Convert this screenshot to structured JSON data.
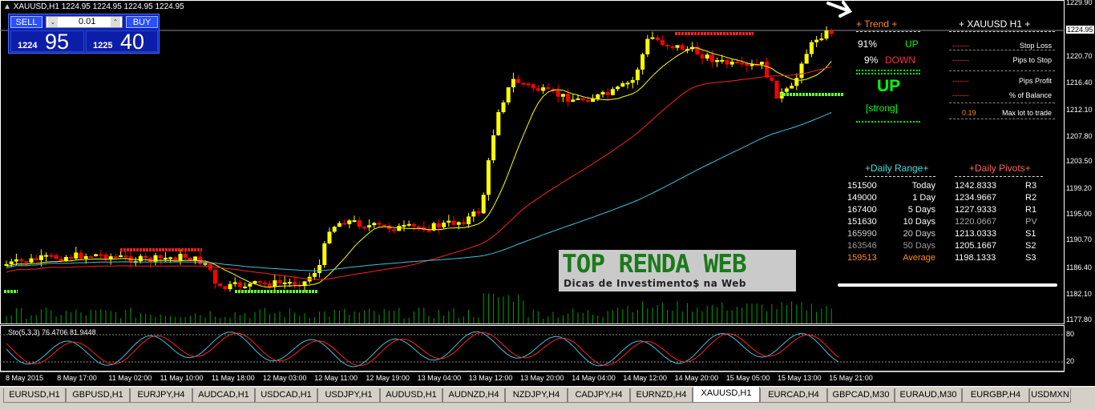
{
  "window": {
    "symbol_header": "XAUUSD,H1  1224.95 1224.95 1224.95 1224.95"
  },
  "trade_panel": {
    "sell_label": "SELL",
    "buy_label": "BUY",
    "lot_value": "0.01",
    "sell_small": "1224",
    "sell_big": "95",
    "buy_small": "1225",
    "buy_big": "40"
  },
  "price_axis": {
    "labels": [
      "1229.90",
      "1224.95",
      "1220.70",
      "1216.40",
      "1212.10",
      "1207.80",
      "1203.50",
      "1199.20",
      "1195.00",
      "1190.70",
      "1186.40",
      "1182.10",
      "1177.80"
    ],
    "current_price": "1224.95",
    "sto_labels": [
      "80",
      "20"
    ]
  },
  "time_axis": {
    "labels": [
      "8 May 2015",
      "8 May 17:00",
      "11 May 02:00",
      "11 May 10:00",
      "11 May 18:00",
      "12 May 03:00",
      "12 May 11:00",
      "12 May 19:00",
      "13 May 04:00",
      "13 May 12:00",
      "13 May 20:00",
      "14 May 04:00",
      "14 May 12:00",
      "14 May 20:00",
      "15 May 05:00",
      "15 May 13:00",
      "15 May 21:00"
    ]
  },
  "stochastic": {
    "label": "Sto(5,3,3) 76.4706 81.9448"
  },
  "trend_panel": {
    "title": "+   Trend   +",
    "up_pct": "91%",
    "up_label": "UP",
    "down_pct": "9%",
    "down_label": "DOWN",
    "direction": "UP",
    "strength": "[strong]"
  },
  "info_panel": {
    "title": "+   XAUUSD  H1   +",
    "rows": [
      {
        "value": "-------",
        "label": "Stop Loss"
      },
      {
        "value": "-------",
        "label": "Pips to Stop"
      },
      {
        "value": "-------",
        "label": "Pips Profit"
      },
      {
        "value": "-------",
        "label": "% of Balance"
      },
      {
        "value": "0.19",
        "label": "Max lot to trade"
      }
    ]
  },
  "daily_range": {
    "title": "+Daily Range+",
    "rows": [
      {
        "value": "151500",
        "label": "Today"
      },
      {
        "value": "149000",
        "label": "1 Day"
      },
      {
        "value": "167400",
        "label": "5 Days"
      },
      {
        "value": "151630",
        "label": "10 Days"
      },
      {
        "value": "165990",
        "label": "20 Days"
      },
      {
        "value": "163546",
        "label": "50 Days"
      },
      {
        "value": "159513",
        "label": "Average"
      }
    ]
  },
  "daily_pivots": {
    "title": "+Daily Pivots+",
    "rows": [
      {
        "value": "1242.8333",
        "label": "R3"
      },
      {
        "value": "1234.9667",
        "label": "R2"
      },
      {
        "value": "1227.9333",
        "label": "R1"
      },
      {
        "value": "1220.0667",
        "label": "PV"
      },
      {
        "value": "1213.0333",
        "label": "S1"
      },
      {
        "value": "1205.1667",
        "label": "S2"
      },
      {
        "value": "1198.1333",
        "label": "S3"
      }
    ]
  },
  "watermark": {
    "title": "TOP RENDA WEB",
    "subtitle": "Dicas de Investimento$ na Web"
  },
  "tabs": [
    {
      "label": "EURUSD,H1",
      "active": false
    },
    {
      "label": "GBPUSD,H1",
      "active": false
    },
    {
      "label": "EURJPY,H4",
      "active": false
    },
    {
      "label": "AUDCAD,H1",
      "active": false
    },
    {
      "label": "USDCAD,H1",
      "active": false
    },
    {
      "label": "USDJPY,H1",
      "active": false
    },
    {
      "label": "AUDUSD,H1",
      "active": false
    },
    {
      "label": "AUDNZD,H4",
      "active": false
    },
    {
      "label": "NZDJPY,H4",
      "active": false
    },
    {
      "label": "CADJPY,H4",
      "active": false
    },
    {
      "label": "EURNZD,H4",
      "active": false
    },
    {
      "label": "XAUUSD,H1",
      "active": true
    },
    {
      "label": "EURCAD,H4",
      "active": false
    },
    {
      "label": "GBPCAD,M30",
      "active": false
    },
    {
      "label": "EURAUD,M30",
      "active": false
    },
    {
      "label": "EURGBP,H4",
      "active": false
    },
    {
      "label": "USDMXN",
      "active": false
    }
  ],
  "colors": {
    "bull": "#ffff00",
    "bear": "#ff0000",
    "ma_fast": "#ffff00",
    "ma_mid": "#ff2020",
    "ma_slow": "#40c0e0",
    "grid": "#808080",
    "trend_green": "#00ff00",
    "accent_orange": "#ff8c1a"
  }
}
